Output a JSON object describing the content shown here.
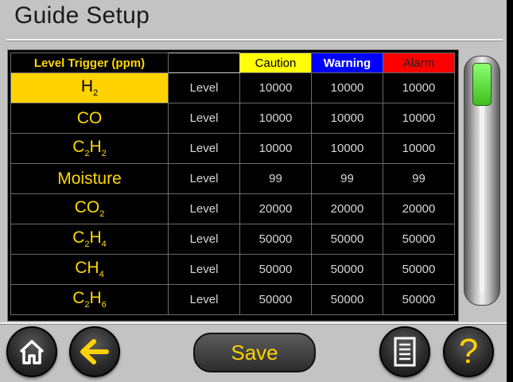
{
  "title": "Guide Setup",
  "table": {
    "headers": {
      "trigger": "Level Trigger (ppm)",
      "blank": "",
      "caution": "Caution",
      "warning": "Warning",
      "alarm": "Alarm"
    },
    "rows": [
      {
        "gas_main": "H",
        "gas_sub": "2",
        "type": "Level",
        "caution": "10000",
        "warning": "10000",
        "alarm": "10000",
        "selected": true
      },
      {
        "gas_main": "CO",
        "gas_sub": "",
        "type": "Level",
        "caution": "10000",
        "warning": "10000",
        "alarm": "10000"
      },
      {
        "gas_main": "C",
        "gas_sub": "2",
        "gas_main2": "H",
        "gas_sub2": "2",
        "type": "Level",
        "caution": "10000",
        "warning": "10000",
        "alarm": "10000"
      },
      {
        "gas_main": "Moisture",
        "gas_sub": "",
        "type": "Level",
        "caution": "99",
        "warning": "99",
        "alarm": "99"
      },
      {
        "gas_main": "CO",
        "gas_sub": "2",
        "type": "Level",
        "caution": "20000",
        "warning": "20000",
        "alarm": "20000"
      },
      {
        "gas_main": "C",
        "gas_sub": "2",
        "gas_main2": "H",
        "gas_sub2": "4",
        "type": "Level",
        "caution": "50000",
        "warning": "50000",
        "alarm": "50000"
      },
      {
        "gas_main": "CH",
        "gas_sub": "4",
        "type": "Level",
        "caution": "50000",
        "warning": "50000",
        "alarm": "50000"
      },
      {
        "gas_main": "C",
        "gas_sub": "2",
        "gas_main2": "H",
        "gas_sub2": "6",
        "type": "Level",
        "caution": "50000",
        "warning": "50000",
        "alarm": "50000"
      }
    ]
  },
  "buttons": {
    "home_icon": "home-icon",
    "back_icon": "arrow-left-icon",
    "save": "Save",
    "list_icon": "document-list-icon",
    "help": "?"
  },
  "colors": {
    "caution": "#ffff00",
    "warning": "#0000ff",
    "alarm": "#ff0000",
    "accent": "#ffd200",
    "scroll_thumb": "#5ee03a"
  }
}
